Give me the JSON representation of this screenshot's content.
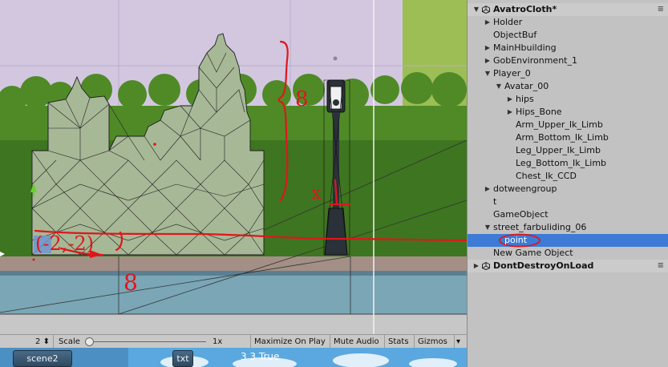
{
  "hierarchy": {
    "items": [
      {
        "label": "AvatroCloth*",
        "depth": 0,
        "expand": "open",
        "kind": "scene"
      },
      {
        "label": "Holder",
        "depth": 1,
        "expand": "closed"
      },
      {
        "label": "ObjectBuf",
        "depth": 1,
        "expand": "none"
      },
      {
        "label": "MainHbuilding",
        "depth": 1,
        "expand": "closed"
      },
      {
        "label": "GobEnvironment_1",
        "depth": 1,
        "expand": "closed"
      },
      {
        "label": "Player_0",
        "depth": 1,
        "expand": "open"
      },
      {
        "label": "Avatar_00",
        "depth": 2,
        "expand": "open"
      },
      {
        "label": "hips",
        "depth": 3,
        "expand": "closed"
      },
      {
        "label": "Hips_Bone",
        "depth": 3,
        "expand": "closed"
      },
      {
        "label": "Arm_Upper_Ik_Limb",
        "depth": 3,
        "expand": "none"
      },
      {
        "label": "Arm_Bottom_Ik_Limb",
        "depth": 3,
        "expand": "none"
      },
      {
        "label": "Leg_Upper_Ik_Limb",
        "depth": 3,
        "expand": "none"
      },
      {
        "label": "Leg_Bottom_Ik_Limb",
        "depth": 3,
        "expand": "none"
      },
      {
        "label": "Chest_Ik_CCD",
        "depth": 3,
        "expand": "none"
      },
      {
        "label": "dotweengroup",
        "depth": 1,
        "expand": "closed"
      },
      {
        "label": "t",
        "depth": 1,
        "expand": "none"
      },
      {
        "label": "GameObject",
        "depth": 1,
        "expand": "none"
      },
      {
        "label": "street_farbuliding_06",
        "depth": 1,
        "expand": "open"
      },
      {
        "label": "point",
        "depth": 2,
        "expand": "none",
        "selected": true
      },
      {
        "label": "New Game Object",
        "depth": 1,
        "expand": "none"
      },
      {
        "label": "DontDestroyOnLoad",
        "depth": 0,
        "expand": "closed",
        "kind": "scene"
      }
    ]
  },
  "toolbar": {
    "display_value": "2",
    "scale_label": "Scale",
    "scale_value": "1x",
    "scale_fraction": 0.02,
    "maximize": "Maximize On Play",
    "mute": "Mute Audio",
    "stats": "Stats",
    "gizmos": "Gizmos"
  },
  "game": {
    "scene_button": "scene2",
    "txt_button": "txt",
    "status_text": "3 3 True"
  },
  "annotations": {
    "height_label": "8",
    "x_label": "x",
    "coord_label": "(-2,-2)",
    "width_label": "8"
  },
  "colors": {
    "sky": "#d3c7e0",
    "mesh": "#a7b896",
    "bush": "#4f8a27",
    "annotation": "#e0161b",
    "selection": "#3d7bd6"
  }
}
